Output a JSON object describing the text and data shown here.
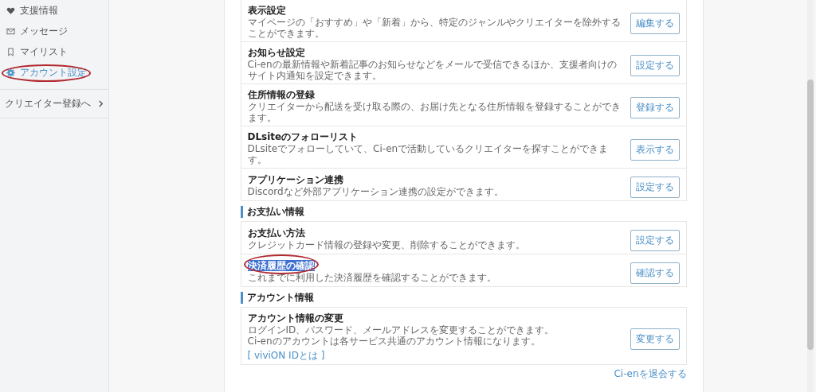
{
  "sidebar": {
    "items": [
      {
        "label": "支援情報",
        "selected": false,
        "circled": false
      },
      {
        "label": "メッセージ",
        "selected": false,
        "circled": false
      },
      {
        "label": "マイリスト",
        "selected": false,
        "circled": false
      },
      {
        "label": "アカウント設定",
        "selected": true,
        "circled": true
      }
    ],
    "creator_link": {
      "label": "クリエイター登録へ"
    }
  },
  "sections": [
    {
      "items": [
        {
          "title": "表示設定",
          "description": "マイページの「おすすめ」や「新着」から、特定のジャンルやクリエイターを除外することができます。",
          "button": "編集する",
          "title_highlighted": false,
          "circled": false
        },
        {
          "title": "お知らせ設定",
          "description": "Ci-enの最新情報や新着記事のお知らせなどをメールで受信できるほか、支援者向けのサイト内通知を設定できます。",
          "button": "設定する",
          "title_highlighted": false,
          "circled": false
        },
        {
          "title": "住所情報の登録",
          "description": "クリエイターから配送を受け取る際の、お届け先となる住所情報を登録することができます。",
          "button": "登録する",
          "title_highlighted": false,
          "circled": false
        },
        {
          "title": "DLsiteのフォローリスト",
          "description": "DLsiteでフォローしていて、Ci-enで活動しているクリエイターを探すことができます。",
          "button": "表示する",
          "title_highlighted": false,
          "circled": false
        },
        {
          "title": "アプリケーション連携",
          "description": "Discordなど外部アプリケーション連携の設定ができます。",
          "button": "設定する",
          "title_highlighted": false,
          "circled": false
        }
      ]
    },
    {
      "heading": "お支払い情報",
      "items": [
        {
          "title": "お支払い方法",
          "description": "クレジットカード情報の登録や変更、削除することができます。",
          "button": "設定する",
          "title_highlighted": false,
          "circled": false
        },
        {
          "title": "決済履歴の確認",
          "description": "これまでに利用した決済履歴を確認することができます。",
          "button": "確認する",
          "title_highlighted": true,
          "circled": true
        }
      ]
    },
    {
      "heading": "アカウント情報",
      "items": [
        {
          "title": "アカウント情報の変更",
          "description": "ログインID、パスワード、メールアドレスを変更することができます。",
          "note": "Ci-enのアカウントは各サービス共通のアカウント情報になります。",
          "link": "[ viviON IDとは ]",
          "button": "変更する",
          "title_highlighted": false,
          "circled": false
        }
      ]
    }
  ],
  "withdraw_link": "Ci-enを退会する"
}
